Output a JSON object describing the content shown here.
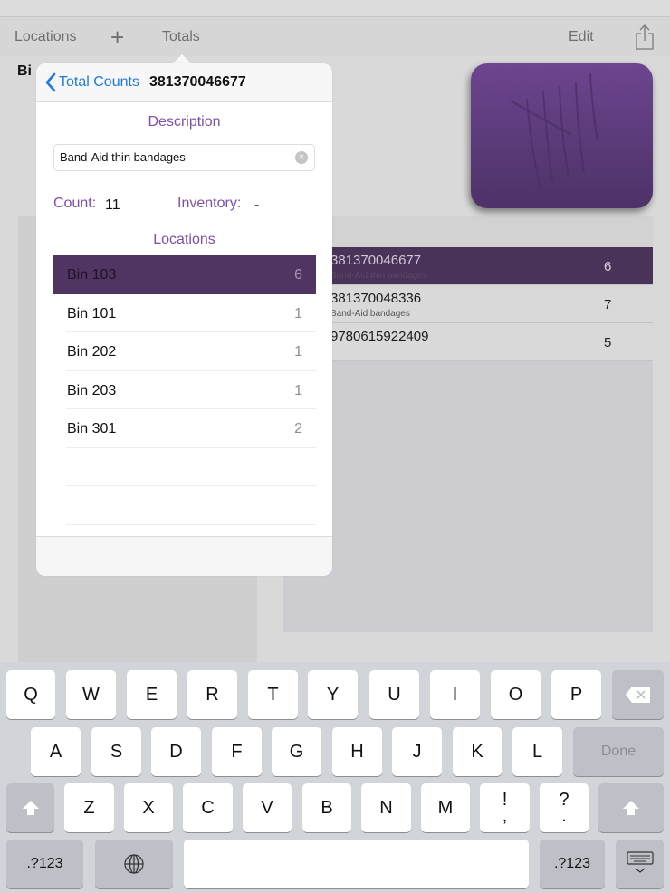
{
  "toolbar": {
    "locations_label": "Locations",
    "add_label": "+",
    "totals_label": "Totals",
    "edit_label": "Edit",
    "share_icon": "share-icon"
  },
  "background": {
    "title_fragment": "Bi",
    "items": [
      {
        "code": "381370046677",
        "description": "Band-Aid thin bandages",
        "count": "6",
        "selected": true
      },
      {
        "code": "381370048336",
        "description": "Band-Aid bandages",
        "count": "7",
        "selected": false
      },
      {
        "code": "9780615922409",
        "description": "",
        "count": "5",
        "selected": false
      }
    ]
  },
  "popover": {
    "back_label": "Total Counts",
    "title": "381370046677",
    "description_label": "Description",
    "description_value": "Band-Aid thin bandages",
    "count_label": "Count:",
    "count_value": "11",
    "inventory_label": "Inventory:",
    "inventory_value": "-",
    "locations_label": "Locations",
    "locations": [
      {
        "name": "Bin 103",
        "count": "6",
        "selected": true
      },
      {
        "name": "Bin 101",
        "count": "1",
        "selected": false
      },
      {
        "name": "Bin 202",
        "count": "1",
        "selected": false
      },
      {
        "name": "Bin 203",
        "count": "1",
        "selected": false
      },
      {
        "name": "Bin 301",
        "count": "2",
        "selected": false
      }
    ]
  },
  "colors": {
    "accent_purple": "#7e4fa8",
    "selected_row": "#503563",
    "link_blue": "#1f7ae0"
  },
  "keyboard": {
    "row1": [
      "Q",
      "W",
      "E",
      "R",
      "T",
      "Y",
      "U",
      "I",
      "O",
      "P"
    ],
    "row2": [
      "A",
      "S",
      "D",
      "F",
      "G",
      "H",
      "J",
      "K",
      "L"
    ],
    "row3": [
      "Z",
      "X",
      "C",
      "V",
      "B",
      "N",
      "M"
    ],
    "punct1": {
      "top": "!",
      "bottom": ","
    },
    "punct2": {
      "top": "?",
      "bottom": "."
    },
    "done_label": "Done",
    "numbers_label": ".?123",
    "backspace_icon": "backspace-icon",
    "shift_icon": "shift-icon",
    "globe_icon": "globe-icon",
    "dismiss_icon": "keyboard-dismiss-icon"
  }
}
